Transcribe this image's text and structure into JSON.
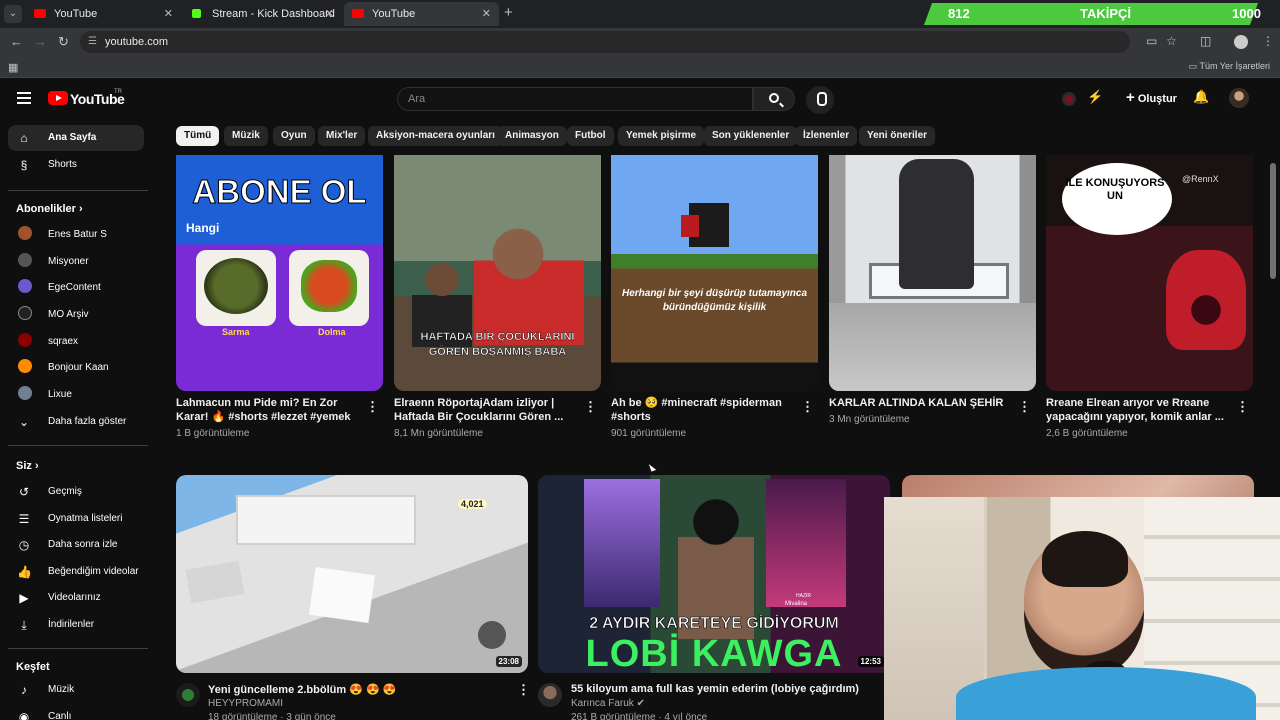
{
  "browser": {
    "tabs": [
      {
        "title": "YouTube",
        "active": false
      },
      {
        "title": "Stream - Kick Dashboard",
        "active": false
      },
      {
        "title": "YouTube",
        "active": true
      }
    ],
    "url": "youtube.com",
    "bookmarks_all": "Tüm Yer İşaretleri"
  },
  "overlay": {
    "followers_current": "812",
    "followers_label": "TAKİPÇİ",
    "followers_goal": "1000",
    "followers_progress": 0.812
  },
  "header": {
    "logo_text": "YouTube",
    "logo_region": "TR",
    "search_placeholder": "Ara",
    "create_label": "Oluştur"
  },
  "sidebar": {
    "main": [
      {
        "label": "Ana Sayfa",
        "icon": "home-icon",
        "active": true
      },
      {
        "label": "Shorts",
        "icon": "shorts-icon",
        "active": false
      }
    ],
    "subs_title": "Abonelikler",
    "subscriptions": [
      {
        "label": "Enes Batur S",
        "color": "#a0522d"
      },
      {
        "label": "Misyoner",
        "color": "#555555"
      },
      {
        "label": "EgeContent",
        "color": "#6a5acd"
      },
      {
        "label": "MO Arşiv",
        "color": "#222222"
      },
      {
        "label": "sqraex",
        "color": "#8b0000"
      },
      {
        "label": "Bonjour Kaan",
        "color": "#ff8c00"
      },
      {
        "label": "Lixue",
        "color": "#708090"
      },
      {
        "label": "Daha fazla göster",
        "color": ""
      }
    ],
    "you_title": "Siz",
    "you": [
      {
        "label": "Geçmiş",
        "icon": "history-icon"
      },
      {
        "label": "Oynatma listeleri",
        "icon": "playlist-icon"
      },
      {
        "label": "Daha sonra izle",
        "icon": "clock-icon"
      },
      {
        "label": "Beğendiğim videolar",
        "icon": "thumb-up-icon"
      },
      {
        "label": "Videolarınız",
        "icon": "video-icon"
      },
      {
        "label": "İndirilenler",
        "icon": "download-icon"
      }
    ],
    "explore_title": "Keşfet",
    "explore": [
      {
        "label": "Müzik",
        "icon": "music-icon"
      },
      {
        "label": "Canlı",
        "icon": "live-icon"
      }
    ]
  },
  "chips": [
    "Tümü",
    "Müzik",
    "Oyun",
    "Mix'ler",
    "Aksiyon-macera oyunları",
    "Animasyon",
    "Futbol",
    "Yemek pişirme",
    "Son yüklenenler",
    "İzlenenler",
    "Yeni öneriler"
  ],
  "shorts": [
    {
      "title": "Lahmacun mu Pide mi? En Zor Karar! 🔥 #shorts #lezzet #yemek",
      "views": "1 B görüntüleme",
      "thumb_text": "ABONE OL",
      "thumb_sub": "Hangi",
      "thumb_a": "Sarma",
      "thumb_b": "Dolma"
    },
    {
      "title": "Elraenn RöportajAdam izliyor | Haftada Bir Çocuklarını Gören ...",
      "views": "8,1 Mn görüntüleme",
      "thumb_text": "HAFTADA BİR ÇOCUKLARINI GÖREN BOŞANMIŞ BABA"
    },
    {
      "title": "Ah be 🥺 #minecraft #spiderman #shorts",
      "views": "901 görüntüleme",
      "thumb_text": "Herhangi bir şeyi düşürüp tutamayınca büründüğümüz kişilik"
    },
    {
      "title": "KARLAR ALTINDA KALAN ŞEHİR",
      "views": "3 Mn görüntüleme"
    },
    {
      "title": "Rreane Elrean arıyor ve Rreane yapacağını yapıyor, komik anlar ...",
      "views": "2,6 B görüntüleme",
      "thumb_text": "ILE KONUŞUYORS UN",
      "thumb_handle": "@RennX"
    }
  ],
  "videos": [
    {
      "title": "Yeni güncelleme 2.bbölüm 😍 😍 😍",
      "channel": "HEYYPROMAMI",
      "meta": "18 görüntüleme · 3 gün önce",
      "duration": "23:08",
      "hud_value": "4,021"
    },
    {
      "title": "55 kiloyum ama full kas yemin ederim (lobiye çağırdım)",
      "channel": "Karınca Faruk",
      "meta": "261 B görüntüleme · 4 yıl önce",
      "duration": "12:53",
      "thumb_line1": "2 AYDIR KARETEYE GİDİYORUM",
      "thumb_line2": "LOBİ KAWGA",
      "card_label": "HAZIR",
      "card_name": "Mivalina"
    }
  ],
  "colors": {
    "bg": "#0f0f0f",
    "accent": "#ff0000",
    "chip": "#272727",
    "follow_bar": "#4cc93e"
  }
}
